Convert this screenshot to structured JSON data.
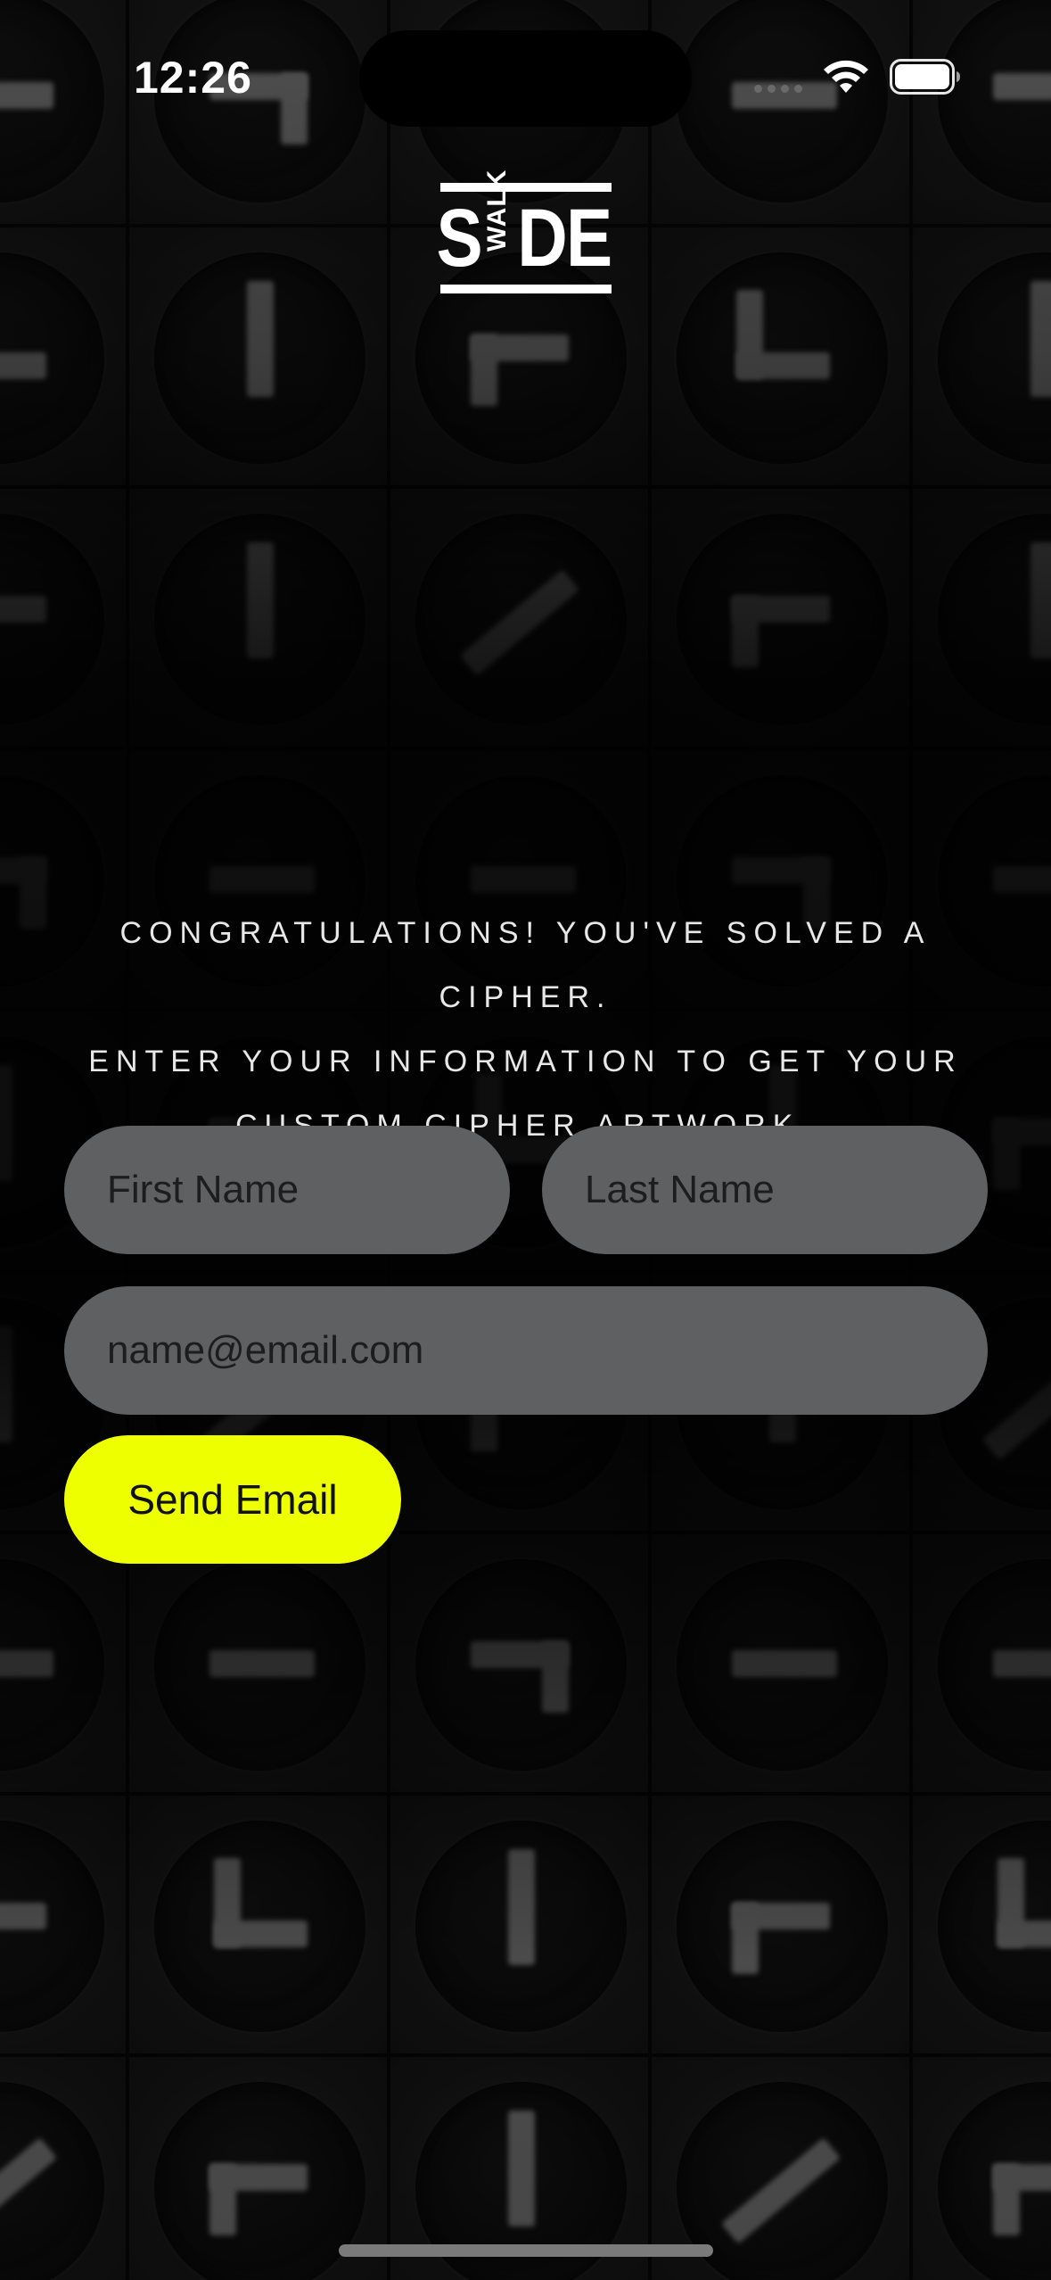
{
  "status_bar": {
    "time": "12:26",
    "icons": [
      "cellular-icon",
      "wifi-icon",
      "battery-icon"
    ]
  },
  "logo": {
    "left_letter": "S",
    "vertical_text": "WALK",
    "right_letters": "DE"
  },
  "message": {
    "lines": [
      "CONGRATULATIONS! YOU'VE SOLVED A CIPHER.",
      "ENTER YOUR INFORMATION TO GET YOUR",
      "CUSTOM CIPHER ARTWORK."
    ]
  },
  "form": {
    "first_name_placeholder": "First Name",
    "last_name_placeholder": "Last Name",
    "email_placeholder": "name@email.com",
    "submit_label": "Send Email"
  },
  "colors": {
    "accent": "#eeff00",
    "field_bg": "#5f6062",
    "background": "#0c0c0c"
  }
}
